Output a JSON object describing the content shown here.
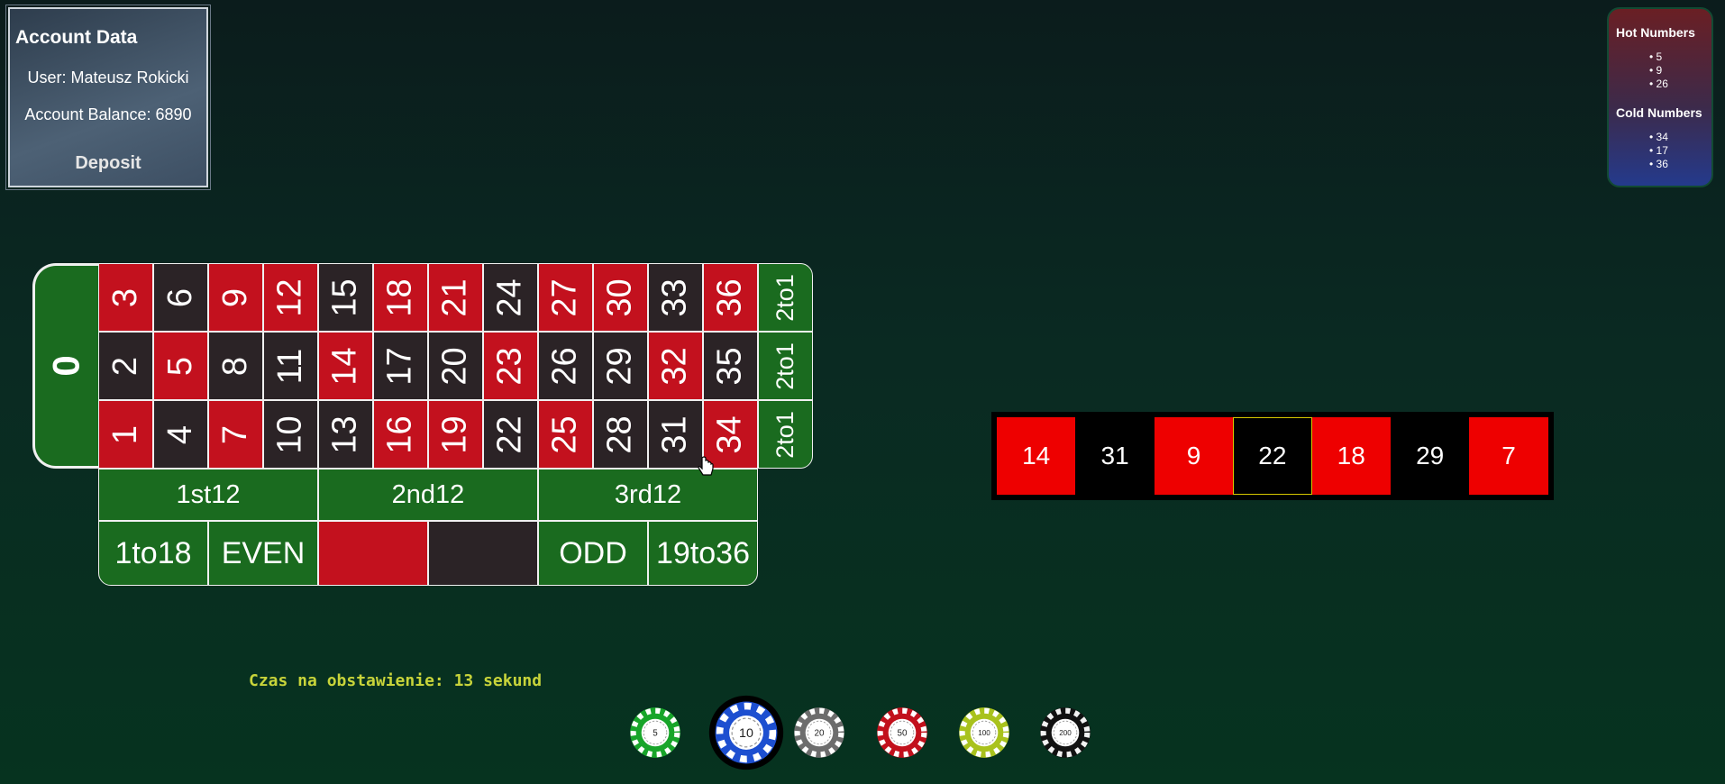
{
  "account": {
    "title": "Account Data",
    "user": "User: Mateusz Rokicki",
    "balance": "Account Balance: 6890",
    "deposit_label": "Deposit"
  },
  "stats": {
    "hot_title": "Hot Numbers",
    "hot": [
      "5",
      "9",
      "26"
    ],
    "cold_title": "Cold Numbers",
    "cold": [
      "34",
      "17",
      "36"
    ]
  },
  "table": {
    "zero": "0",
    "rows": [
      [
        {
          "n": "3",
          "c": "red"
        },
        {
          "n": "6",
          "c": "black"
        },
        {
          "n": "9",
          "c": "red"
        },
        {
          "n": "12",
          "c": "red"
        },
        {
          "n": "15",
          "c": "black"
        },
        {
          "n": "18",
          "c": "red"
        },
        {
          "n": "21",
          "c": "red"
        },
        {
          "n": "24",
          "c": "black"
        },
        {
          "n": "27",
          "c": "red"
        },
        {
          "n": "30",
          "c": "red"
        },
        {
          "n": "33",
          "c": "black"
        },
        {
          "n": "36",
          "c": "red"
        }
      ],
      [
        {
          "n": "2",
          "c": "black"
        },
        {
          "n": "5",
          "c": "red"
        },
        {
          "n": "8",
          "c": "black"
        },
        {
          "n": "11",
          "c": "black"
        },
        {
          "n": "14",
          "c": "red"
        },
        {
          "n": "17",
          "c": "black"
        },
        {
          "n": "20",
          "c": "black"
        },
        {
          "n": "23",
          "c": "red"
        },
        {
          "n": "26",
          "c": "black"
        },
        {
          "n": "29",
          "c": "black"
        },
        {
          "n": "32",
          "c": "red"
        },
        {
          "n": "35",
          "c": "black"
        }
      ],
      [
        {
          "n": "1",
          "c": "red"
        },
        {
          "n": "4",
          "c": "black"
        },
        {
          "n": "7",
          "c": "red"
        },
        {
          "n": "10",
          "c": "black"
        },
        {
          "n": "13",
          "c": "black"
        },
        {
          "n": "16",
          "c": "red"
        },
        {
          "n": "19",
          "c": "red"
        },
        {
          "n": "22",
          "c": "black"
        },
        {
          "n": "25",
          "c": "red"
        },
        {
          "n": "28",
          "c": "black"
        },
        {
          "n": "31",
          "c": "black"
        },
        {
          "n": "34",
          "c": "red"
        }
      ]
    ],
    "columns": [
      "2to1",
      "2to1",
      "2to1"
    ],
    "dozens": [
      "1st12",
      "2nd12",
      "3rd12"
    ],
    "outside": [
      "1to18",
      "EVEN",
      "",
      "",
      "ODD",
      "19to36"
    ]
  },
  "history": [
    {
      "n": "14",
      "c": "red"
    },
    {
      "n": "31",
      "c": "black"
    },
    {
      "n": "9",
      "c": "red"
    },
    {
      "n": "22",
      "c": "black"
    },
    {
      "n": "18",
      "c": "red"
    },
    {
      "n": "29",
      "c": "black"
    },
    {
      "n": "7",
      "c": "red"
    }
  ],
  "timer": "Czas na obstawienie: 13 sekund",
  "chips": [
    {
      "value": "5",
      "color": "#18a52a"
    },
    {
      "value": "10",
      "color": "#1d4fd0",
      "selected": true
    },
    {
      "value": "20",
      "color": "#6d6d6d"
    },
    {
      "value": "50",
      "color": "#c2101c"
    },
    {
      "value": "100",
      "color": "#a9c21d"
    },
    {
      "value": "200",
      "color": "#111111"
    }
  ]
}
